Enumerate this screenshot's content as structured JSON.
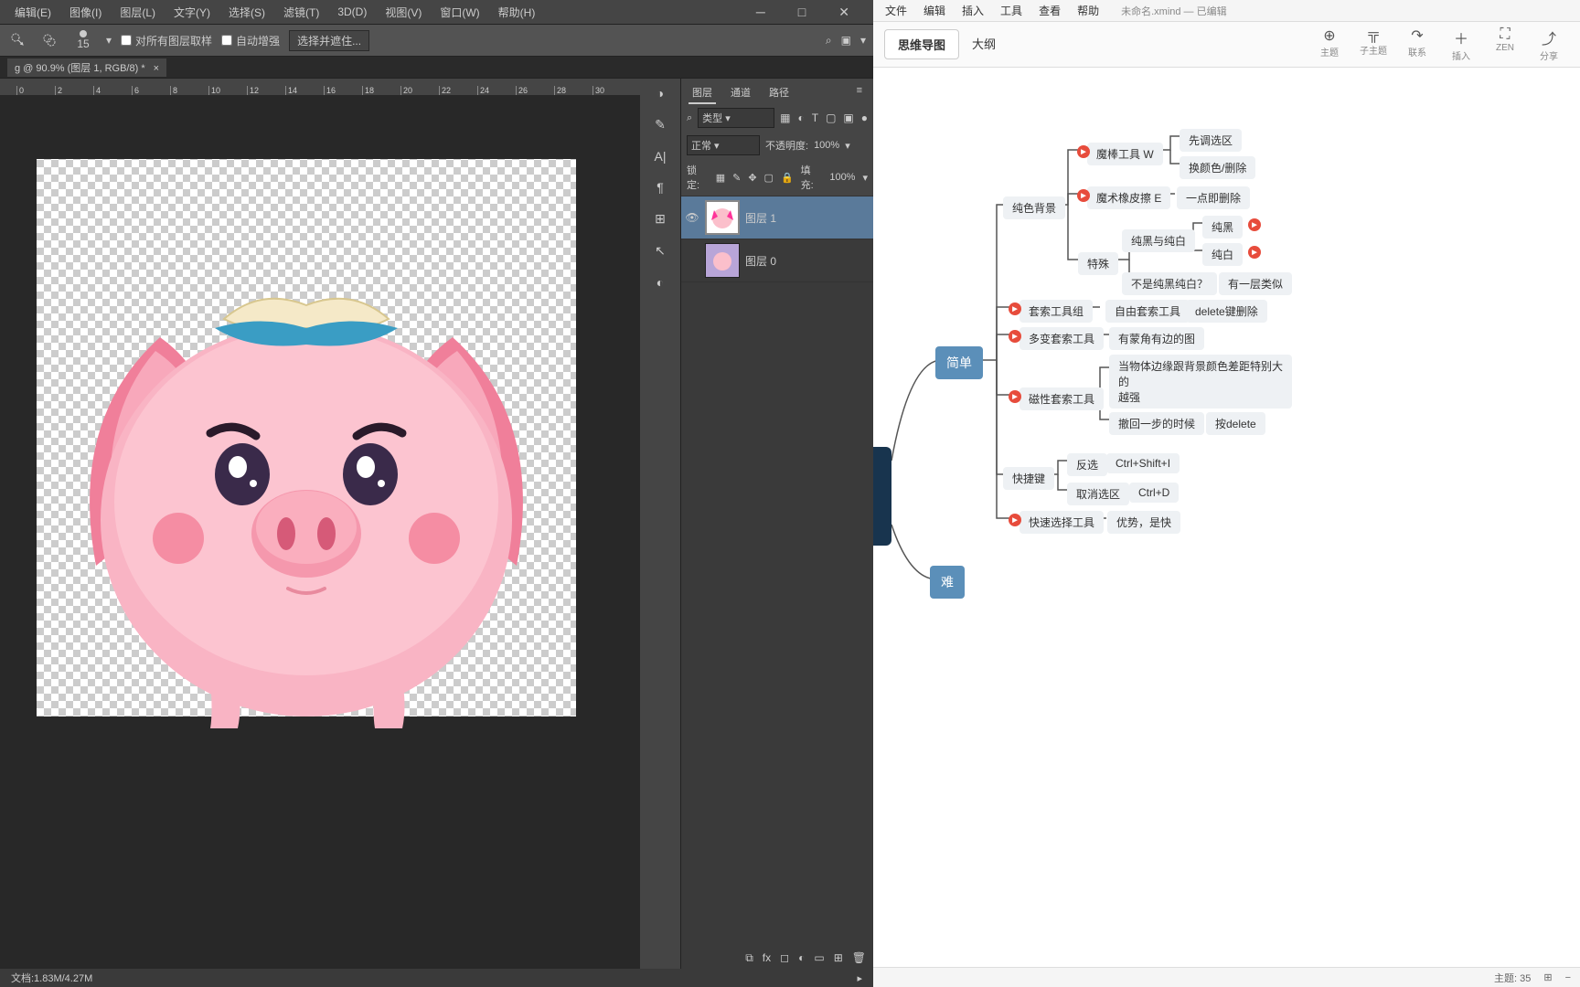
{
  "ps": {
    "menu": [
      "编辑(E)",
      "图像(I)",
      "图层(L)",
      "文字(Y)",
      "选择(S)",
      "滤镜(T)",
      "3D(D)",
      "视图(V)",
      "窗口(W)",
      "帮助(H)"
    ],
    "brush_size": "15",
    "opt_sample_all": "对所有图层取样",
    "opt_auto_enhance": "自动增强",
    "opt_select_subject": "选择并遮住...",
    "tab_title": "g @ 90.9% (图层 1, RGB/8) *",
    "ruler_marks": [
      "0",
      "2",
      "4",
      "6",
      "8",
      "10",
      "12",
      "14",
      "16",
      "18",
      "20",
      "22",
      "24",
      "26",
      "28",
      "30"
    ],
    "panel_tabs": [
      "图层",
      "通道",
      "路径"
    ],
    "filter_label": "类型",
    "blend_mode": "正常",
    "opacity_label": "不透明度:",
    "opacity_val": "100%",
    "lock_label": "锁定:",
    "fill_label": "填充:",
    "fill_val": "100%",
    "layers": [
      {
        "name": "图层 1",
        "selected": true,
        "visible": true
      },
      {
        "name": "图层 0",
        "selected": false,
        "visible": false
      }
    ],
    "doc_info": "文档:1.83M/4.27M"
  },
  "xm": {
    "menu": [
      "文件",
      "编辑",
      "插入",
      "工具",
      "查看",
      "帮助"
    ],
    "doc_title": "未命名.xmind  — 已编辑",
    "view_tabs": [
      "思维导图",
      "大纲"
    ],
    "tools": [
      {
        "icon": "⊕",
        "label": "主题"
      },
      {
        "icon": "╦",
        "label": "子主题"
      },
      {
        "icon": "↷",
        "label": "联系"
      },
      {
        "icon": "＋",
        "label": "插入"
      },
      {
        "icon": "⛶",
        "label": "ZEN"
      },
      {
        "icon": "⤴",
        "label": "分享"
      }
    ],
    "nodes": {
      "easy": "简单",
      "hard": "难",
      "pure_bg": "纯色背景",
      "lasso_group": "套索工具组",
      "poly_lasso": "多变套索工具",
      "magnetic": "磁性套索工具",
      "shortcut": "快捷键",
      "quick_select": "快速选择工具",
      "magic_wand": "魔棒工具   W",
      "magic_eraser": "魔术橡皮擦   E",
      "special": "特殊",
      "free_lasso": "自由套索工具",
      "poly_note": "有蒙角有边的图",
      "mag_note1": "当物体边缘跟背景颜色差距特别大的",
      "mag_note1b": "越强",
      "mag_note2": "撤回一步的时候",
      "invert": "反选",
      "deselect": "取消选区",
      "invert_key": "Ctrl+Shift+I",
      "deselect_key": "Ctrl+D",
      "quick_note": "优势，是快",
      "wand_1": "先调选区",
      "wand_2": "换颜色/删除",
      "eraser_1": "一点即删除",
      "bw": "纯黑与纯白",
      "black": "纯黑",
      "white": "纯白",
      "not_bw": "不是纯黑纯白？",
      "not_bw_note": "有一层类似",
      "delete_key": "delete键删除",
      "press_delete": "按delete"
    },
    "status_topic": "主题: 35"
  }
}
